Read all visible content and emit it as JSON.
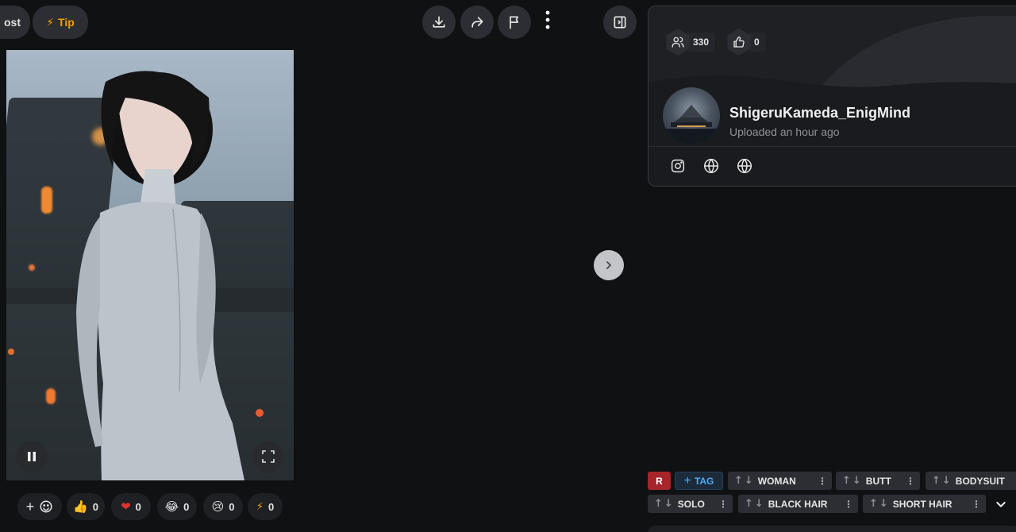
{
  "toolbar": {
    "post_label": "ost",
    "tip_label": "Tip"
  },
  "reactions": {
    "add_label": "+",
    "like": "0",
    "heart": "0",
    "laugh": "0",
    "cry": "0",
    "buzz": "0"
  },
  "stats": {
    "followers": "330",
    "likes": "0"
  },
  "creator": {
    "username": "ShigeruKameda_EnigMind",
    "uploaded": "Uploaded an hour ago"
  },
  "tags": {
    "rating": "R",
    "add_tag": "TAG",
    "items": [
      "WOMAN",
      "BUTT",
      "BODYSUIT",
      "SOLO",
      "BLACK HAIR",
      "SHORT HAIR"
    ]
  },
  "colors": {
    "background": "#101113",
    "rating_badge": "#a6252a",
    "tip_accent": "#f59f00",
    "add_tag_accent": "#4dabf7"
  }
}
